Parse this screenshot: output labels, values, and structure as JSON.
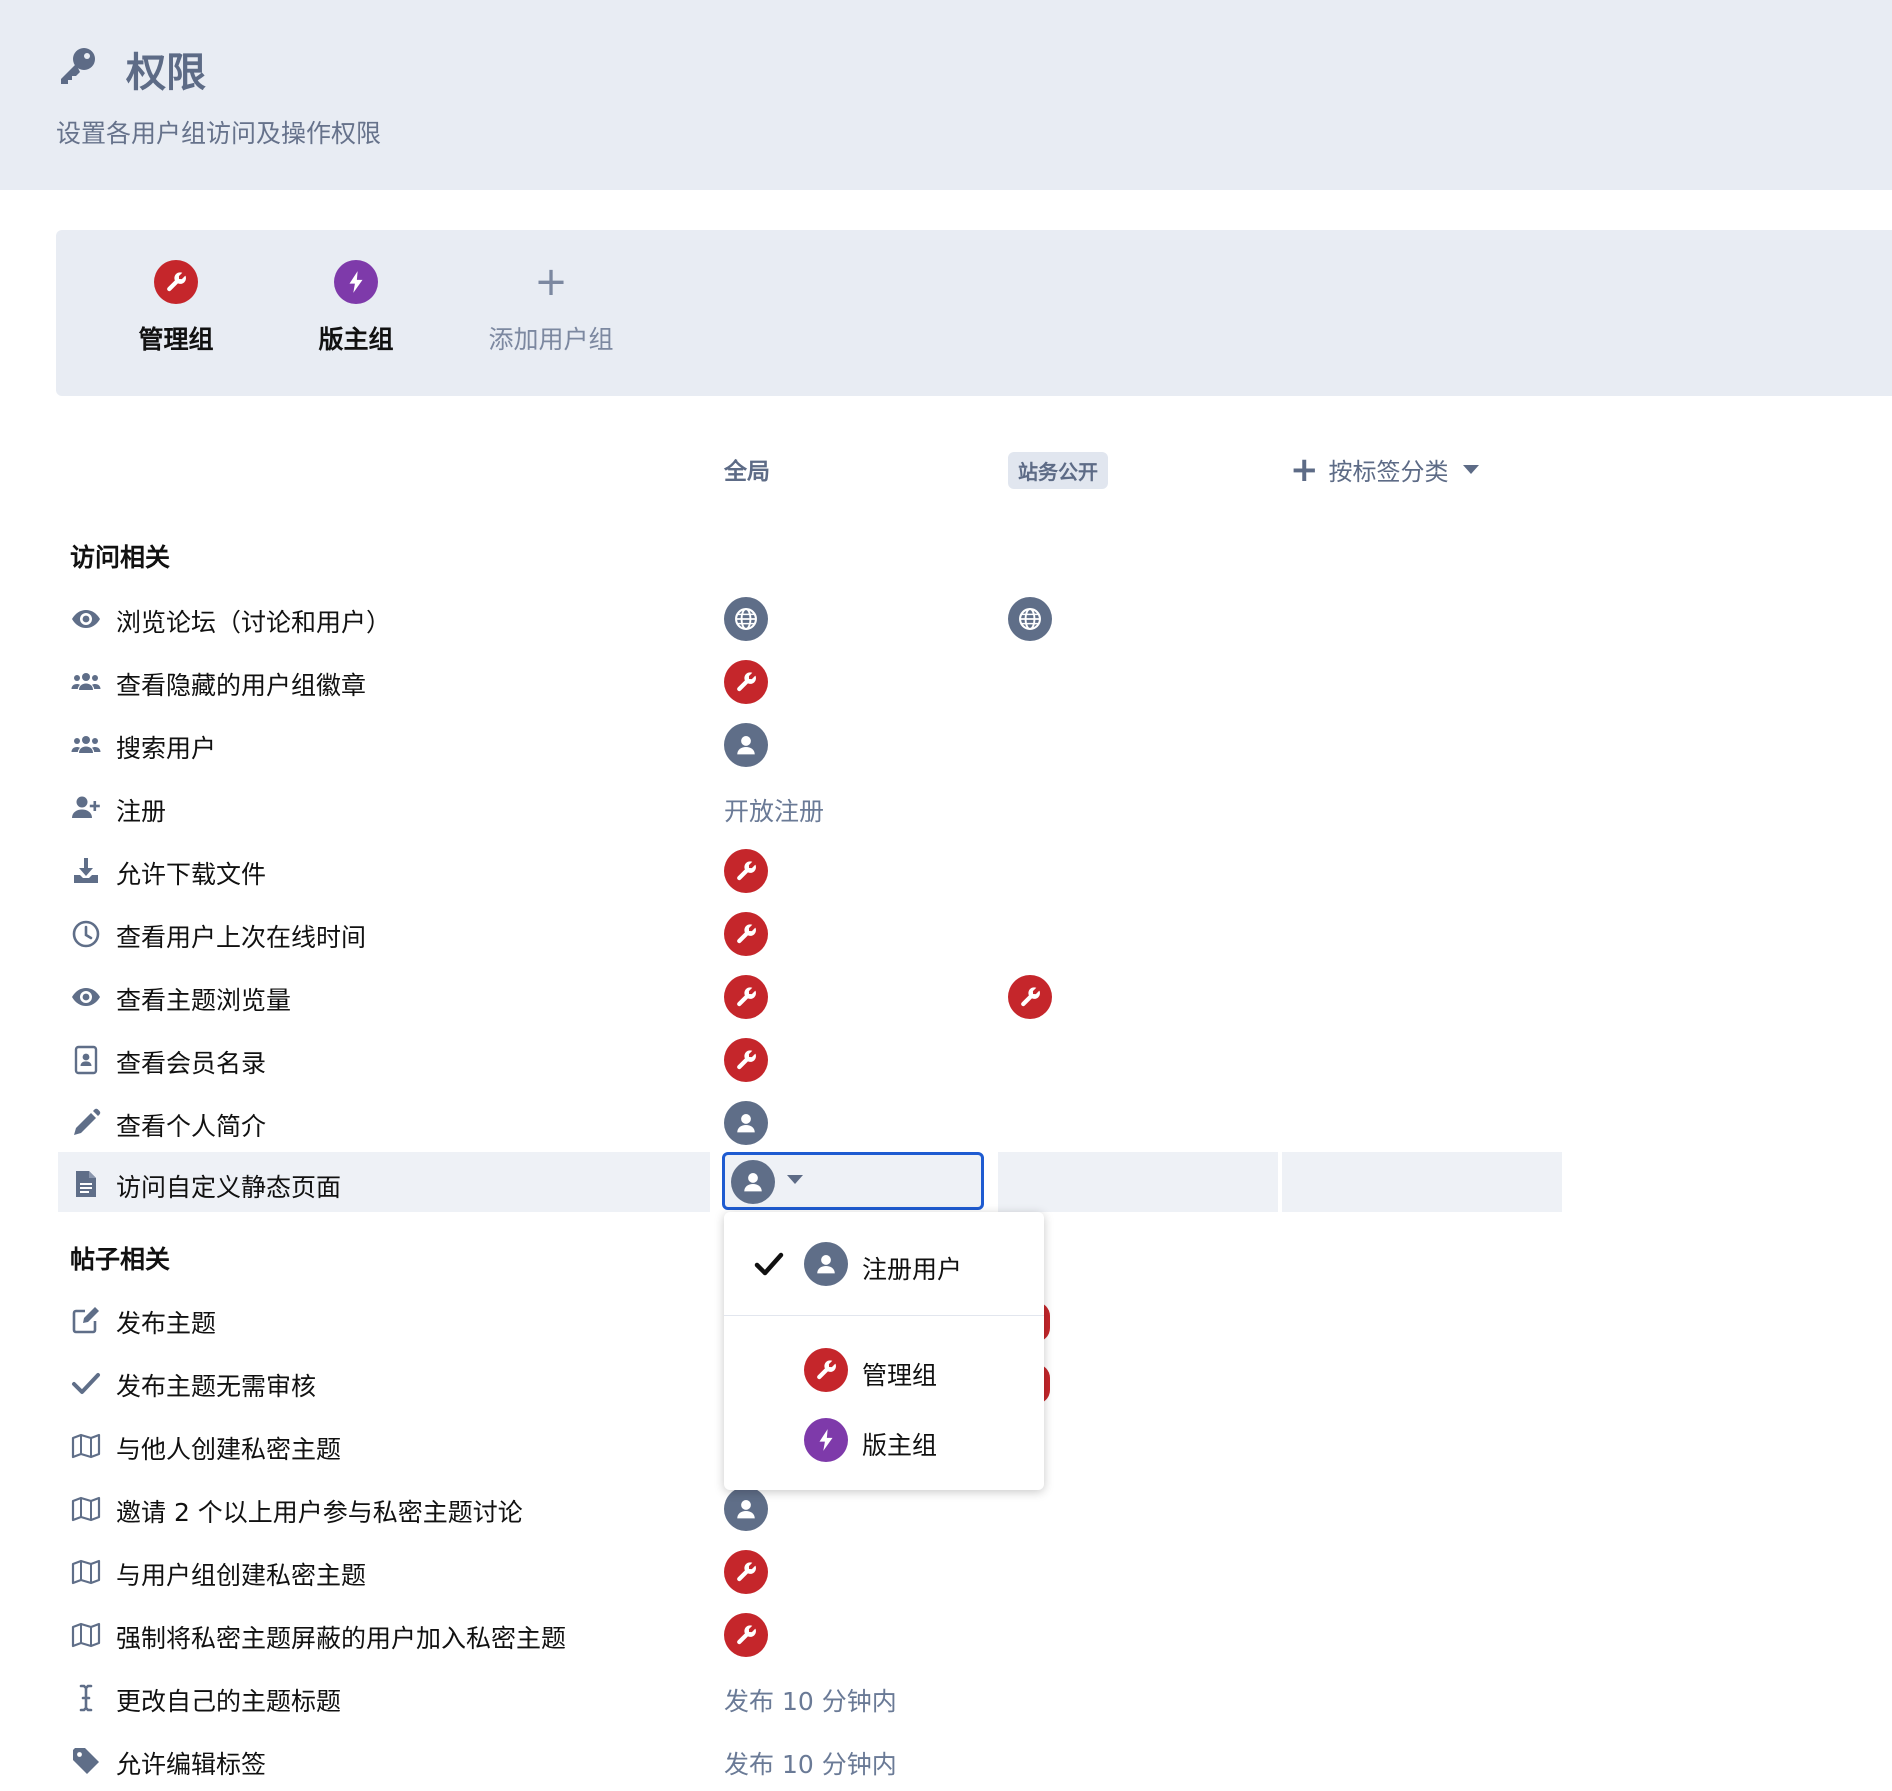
{
  "header": {
    "title": "权限",
    "subtitle": "设置各用户组访问及操作权限"
  },
  "groups": [
    {
      "label": "管理组",
      "icon": "wrench-icon",
      "color": "#c5262b"
    },
    {
      "label": "版主组",
      "icon": "bolt-icon",
      "color": "#7e3aaa"
    }
  ],
  "add_group_label": "添加用户组",
  "columns": {
    "global": "全局",
    "tag": "站务公开",
    "by_tag": "按标签分类"
  },
  "sections": {
    "access": "访问相关",
    "posts": "帖子相关"
  },
  "rows": [
    {
      "label": "浏览论坛（讨论和用户）",
      "icon": "eye-icon",
      "global": "globe",
      "tag": "globe"
    },
    {
      "label": "查看隐藏的用户组徽章",
      "icon": "users-icon",
      "global": "admin"
    },
    {
      "label": "搜索用户",
      "icon": "users-icon",
      "global": "user"
    },
    {
      "label": "注册",
      "icon": "user-plus-icon",
      "global_text": "开放注册"
    },
    {
      "label": "允许下载文件",
      "icon": "download-icon",
      "global": "admin"
    },
    {
      "label": "查看用户上次在线时间",
      "icon": "clock-icon",
      "global": "admin"
    },
    {
      "label": "查看主题浏览量",
      "icon": "eye-icon",
      "global": "admin",
      "tag": "admin"
    },
    {
      "label": "查看会员名录",
      "icon": "address-book-icon",
      "global": "admin"
    },
    {
      "label": "查看个人简介",
      "icon": "pencil-icon",
      "global": "user"
    },
    {
      "label": "访问自定义静态页面",
      "icon": "file-icon",
      "global": "user"
    },
    {
      "label": "发布主题",
      "icon": "edit-icon"
    },
    {
      "label": "发布主题无需审核",
      "icon": "check-icon"
    },
    {
      "label": "与他人创建私密主题",
      "icon": "map-icon"
    },
    {
      "label": "邀请 2 个以上用户参与私密主题讨论",
      "icon": "map-icon",
      "global": "user"
    },
    {
      "label": "与用户组创建私密主题",
      "icon": "map-icon",
      "global": "admin"
    },
    {
      "label": "强制将私密主题屏蔽的用户加入私密主题",
      "icon": "map-icon",
      "global": "admin"
    },
    {
      "label": "更改自己的主题标题",
      "icon": "i-cursor-icon",
      "global_text": "发布 10 分钟内"
    },
    {
      "label": "允许编辑标签",
      "icon": "tag-icon",
      "global_text": "发布 10 分钟内"
    }
  ],
  "dropdown": {
    "items": [
      {
        "label": "注册用户",
        "selected": true
      },
      {
        "label": "管理组",
        "selected": false
      },
      {
        "label": "版主组",
        "selected": false
      }
    ]
  }
}
